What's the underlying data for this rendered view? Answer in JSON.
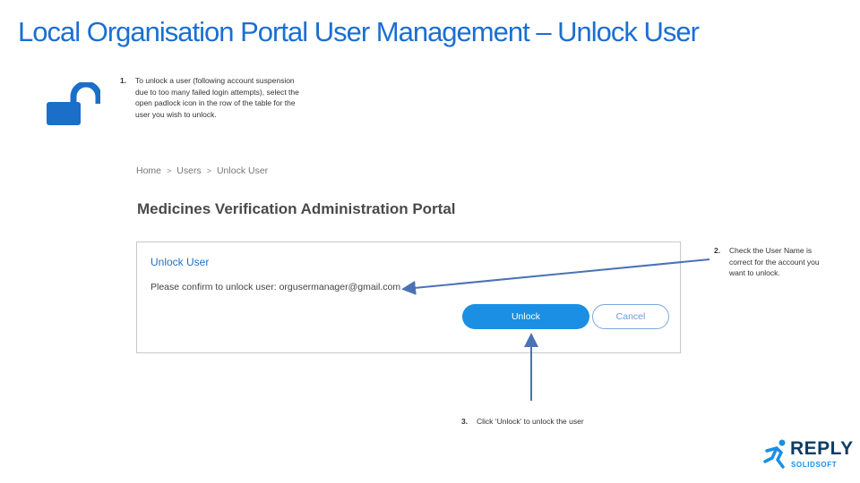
{
  "slide": {
    "title": "Local Organisation Portal User Management – Unlock User"
  },
  "steps": [
    {
      "num": "1.",
      "text": "To unlock a user (following account suspension due to too many failed login attempts), select the open padlock icon in the row of the table for the user you wish to unlock."
    },
    {
      "num": "2.",
      "text": "Check the User Name is correct for the account you want to unlock."
    },
    {
      "num": "3.",
      "text": "Click ‘Unlock’ to unlock the user"
    }
  ],
  "icons": {
    "padlock": "open-padlock-icon",
    "breadcrumb_separator": "chevron-right-icon"
  },
  "breadcrumb": [
    "Home",
    "Users",
    "Unlock User"
  ],
  "breadcrumb_sep": ">",
  "portal": {
    "title": "Medicines Verification Administration Portal"
  },
  "dialog": {
    "title": "Unlock User",
    "message": "Please confirm to unlock user: orgusermanager@gmail.com",
    "unlock_label": "Unlock",
    "cancel_label": "Cancel"
  },
  "logo": {
    "word": "REPLY",
    "sub": "SOLIDSOFT"
  },
  "colors": {
    "title": "#1a6fd1",
    "padlock": "#1b6fc9",
    "primary_button": "#1a8fe3",
    "arrow": "#4a72b5",
    "logo_dark": "#0f3c66",
    "logo_accent": "#1a8fe3"
  }
}
